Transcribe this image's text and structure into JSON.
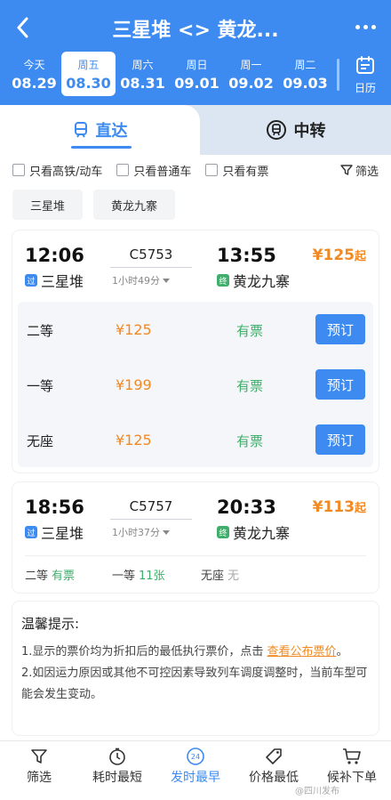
{
  "header": {
    "title": "三星堆 <> 黄龙...",
    "dates": [
      {
        "weekday": "今天",
        "date": "08.29",
        "selected": false
      },
      {
        "weekday": "周五",
        "date": "08.30",
        "selected": true
      },
      {
        "weekday": "周六",
        "date": "08.31",
        "selected": false
      },
      {
        "weekday": "周日",
        "date": "09.01",
        "selected": false
      },
      {
        "weekday": "周一",
        "date": "09.02",
        "selected": false
      },
      {
        "weekday": "周二",
        "date": "09.03",
        "selected": false
      }
    ],
    "calendar_label": "日历"
  },
  "tabs": {
    "direct": "直达",
    "transfer": "中转"
  },
  "filters": {
    "high_speed": "只看高铁/动车",
    "normal": "只看普通车",
    "available": "只看有票",
    "filter": "筛选"
  },
  "stations": [
    "三星堆",
    "黄龙九寨"
  ],
  "trains": [
    {
      "dep_time": "12:06",
      "dep_station": "三星堆",
      "dep_tag": "过",
      "train_no": "C5753",
      "duration": "1小时49分",
      "arr_time": "13:55",
      "arr_station": "黄龙九寨",
      "arr_tag": "终",
      "price": "¥125",
      "price_suffix": "起",
      "seats": [
        {
          "name": "二等",
          "price": "¥125",
          "availability": "有票",
          "book": "预订"
        },
        {
          "name": "一等",
          "price": "¥199",
          "availability": "有票",
          "book": "预订"
        },
        {
          "name": "无座",
          "price": "¥125",
          "availability": "有票",
          "book": "预订"
        }
      ]
    },
    {
      "dep_time": "18:56",
      "dep_station": "三星堆",
      "dep_tag": "过",
      "train_no": "C5757",
      "duration": "1小时37分",
      "arr_time": "20:33",
      "arr_station": "黄龙九寨",
      "arr_tag": "终",
      "price": "¥113",
      "price_suffix": "起",
      "seat_summary": [
        {
          "name": "二等",
          "status": "有票"
        },
        {
          "name": "一等",
          "status": "11张"
        },
        {
          "name": "无座",
          "status": "无"
        }
      ]
    }
  ],
  "tips": {
    "title": "温馨提示:",
    "line1_prefix": "1.显示的票价均为折扣后的最低执行票价，点击",
    "line1_link": "查看公布票价",
    "line1_suffix": "。",
    "line2": "2.如因运力原因或其他不可控因素导致列车调度调整时，当前车型可能会发生变动。"
  },
  "bottom_bar": [
    {
      "label": "筛选",
      "icon": "filter-icon"
    },
    {
      "label": "耗时最短",
      "icon": "clock-icon"
    },
    {
      "label": "发时最早",
      "icon": "24h-icon",
      "active": true
    },
    {
      "label": "价格最低",
      "icon": "price-tag-icon"
    },
    {
      "label": "候补下单",
      "icon": "cart-icon"
    }
  ],
  "icon_badge_24": "24",
  "watermark": "@四川发布",
  "colors": {
    "primary": "#3d8bf0",
    "price": "#f08a24",
    "available": "#3fae6b"
  }
}
